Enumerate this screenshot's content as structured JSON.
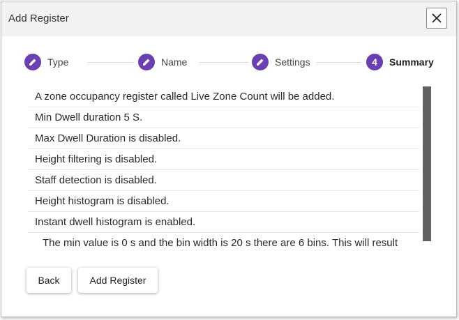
{
  "dialog": {
    "title": "Add Register",
    "close_icon": "close-icon"
  },
  "stepper": {
    "steps": [
      {
        "label": "Type",
        "icon": "pencil-icon",
        "state": "completed"
      },
      {
        "label": "Name",
        "icon": "pencil-icon",
        "state": "completed"
      },
      {
        "label": "Settings",
        "icon": "pencil-icon",
        "state": "completed"
      },
      {
        "label": "Summary",
        "number": "4",
        "state": "active"
      }
    ]
  },
  "summary": {
    "lines": [
      "A zone occupancy register called Live Zone Count will be added.",
      "Min Dwell duration 5 S.",
      "Max Dwell Duration is disabled.",
      "Height filtering is disabled.",
      "Staff detection is disabled.",
      "Height histogram is disabled.",
      "Instant dwell histogram is enabled."
    ],
    "detail": "The min value is 0 s and the bin width is 20 s there are 6 bins. This will result"
  },
  "footer": {
    "back_label": "Back",
    "add_label": "Add Register"
  },
  "colors": {
    "accent": "#6a3fb3",
    "title_bar": "#f2f2f2",
    "scrollbar": "#616161"
  }
}
